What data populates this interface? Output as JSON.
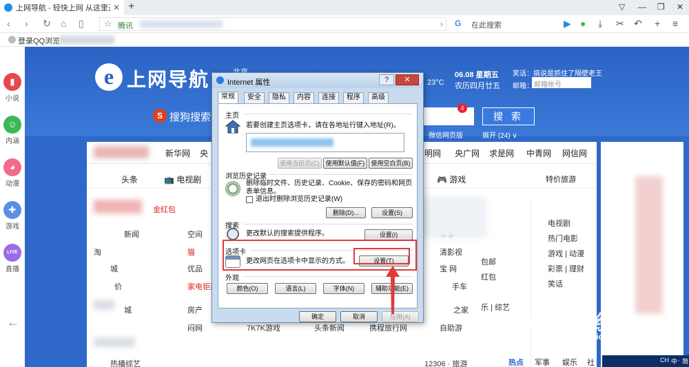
{
  "browser": {
    "tab_title": "上网导航 - 轻快上网 从这里开始",
    "tab_close": "✕",
    "new_tab": "+",
    "url_site": "腾讯",
    "search_placeholder": "在此搜索",
    "bookmark_label": "登录QQ浏览"
  },
  "sidebar": {
    "items": [
      {
        "label": "小说",
        "color": "#e8484b",
        "glyph": "▮"
      },
      {
        "label": "内涵",
        "color": "#3cb857",
        "glyph": "☺"
      },
      {
        "label": "动漫",
        "color": "#f26c8a",
        "glyph": "◕"
      },
      {
        "label": "游戏",
        "color": "#5b8ee6",
        "glyph": "✚"
      },
      {
        "label": "直播",
        "color": "#9c6ce6",
        "glyph": "LIVE"
      }
    ]
  },
  "page": {
    "logo_text": "上网导航",
    "city": "北京",
    "temp": "23°C",
    "date": "06.08 星期五",
    "lunar": "农历四月廿五",
    "joke": "笑话：搞说是抓住了隔壁老王",
    "mail_label": "邮箱：",
    "mail_placeholder": "邮箱帐号",
    "sogou": "搜狗搜索",
    "search_badge": "4",
    "search_button": "搜 索",
    "hot_links": "微信网页版",
    "expand": "展开 (24) ∨",
    "nav_links": [
      "新华网",
      "央",
      "明网",
      "央广网",
      "求是网",
      "中青网",
      "网信网"
    ],
    "categories": [
      "头条",
      "电视剧",
      "游戏",
      "特价旅游"
    ],
    "cells": [
      "新闻",
      "空间",
      "军事",
      "淘",
      "猫",
      "清影视",
      "城",
      "优品",
      "宝 网",
      "价",
      "家电钜惠",
      "手车",
      "城",
      "房产",
      "之家",
      "闷网",
      "7K7K游戏",
      "头条新闻",
      "携程旅行网",
      "自助游",
      "热播综艺",
      "12306 · 旅游"
    ],
    "right_links": [
      "电视剧",
      "热门电影",
      "游戏 | 动漫",
      "彩票 | 理财",
      "笑话",
      "包邮",
      "红包",
      "乐 | 综艺"
    ],
    "right_tabs": [
      "热点",
      "军事",
      "娱乐",
      "社会"
    ],
    "baidu": "Baidu 经验",
    "baidu_url": "jingyan.baidu.com",
    "taskbar": [
      "CH",
      "中",
      "·",
      "简"
    ]
  },
  "dialog": {
    "title": "Internet 属性",
    "help": "?",
    "close": "✕",
    "tabs": [
      "常规",
      "安全",
      "隐私",
      "内容",
      "连接",
      "程序",
      "高级"
    ],
    "home": {
      "title": "主页",
      "desc": "若要创建主页选项卡，请在各地址行键入地址(R)。",
      "btn_current": "使用当前页(C)",
      "btn_default": "使用默认值(F)",
      "btn_blank": "使用空白页(B)"
    },
    "history": {
      "title": "浏览历史记录",
      "desc": "删除临时文件、历史记录、Cookie、保存的密码和网页表单信息。",
      "checkbox": "退出时删除浏览历史记录(W)",
      "btn_delete": "删除(D)...",
      "btn_settings": "设置(S)"
    },
    "search": {
      "title": "搜索",
      "desc": "更改默认的搜索提供程序。",
      "btn_settings": "设置(I)"
    },
    "tabsgroup": {
      "title": "选项卡",
      "desc": "更改网页在选项卡中显示的方式。",
      "btn_settings": "设置(T)"
    },
    "appearance": {
      "title": "外观",
      "btn_colors": "颜色(O)",
      "btn_language": "语言(L)",
      "btn_fonts": "字体(N)",
      "btn_access": "辅助功能(E)"
    },
    "footer": {
      "ok": "确定",
      "cancel": "取消",
      "apply": "应用(A)"
    }
  }
}
